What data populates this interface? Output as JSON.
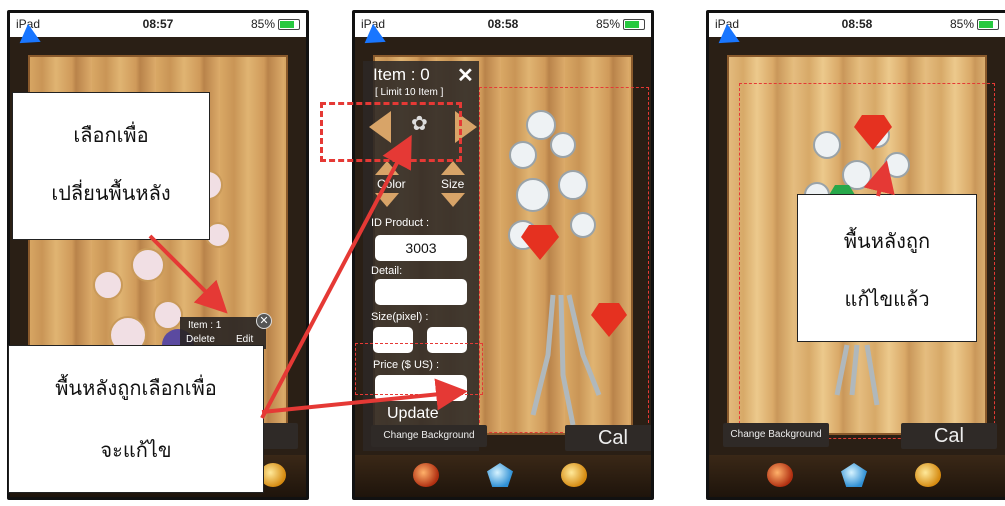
{
  "screens": [
    {
      "status": {
        "carrier": "iPad",
        "time": "08:57",
        "battery": "85%"
      },
      "item_popup": {
        "title": "Item : 1",
        "delete": "Delete",
        "edit": "Edit"
      },
      "cal_label": "al",
      "annotation_top": {
        "line1": "เลือกเพื่อ",
        "line2": "เปลี่ยนพื้นหลัง"
      },
      "annotation_bottom": {
        "line1": "พื้นหลังถูกเลือกเพื่อ",
        "line2": "จะแก้ไข"
      }
    },
    {
      "status": {
        "carrier": "iPad",
        "time": "08:58",
        "battery": "85%"
      },
      "panel": {
        "item_title": "Item : 0",
        "limit": "[ Limit 10 Item ]",
        "color_label": "Color",
        "size_label": "Size",
        "id_product_label": "ID Product :",
        "id_product_value": "3003",
        "detail_label": "Detail:",
        "detail_value": "",
        "size_pixel_label": "Size(pixel) :",
        "size_w": "",
        "size_h": "",
        "price_label": "Price ($ US) :",
        "price_value": "",
        "update_label": "Update"
      },
      "change_background": "Change Background",
      "cal_label": "Cal"
    },
    {
      "status": {
        "carrier": "iPad",
        "time": "08:58",
        "battery": "85%"
      },
      "annotation": {
        "line1": "พื้นหลังถูก",
        "line2": "แก้ไขแล้ว"
      },
      "change_background": "Change Background",
      "cal_label": "Cal"
    }
  ],
  "colors": {
    "annotation_arrow": "#e53935",
    "wood": "#d9a865",
    "back_arrow": "#1976ff"
  }
}
